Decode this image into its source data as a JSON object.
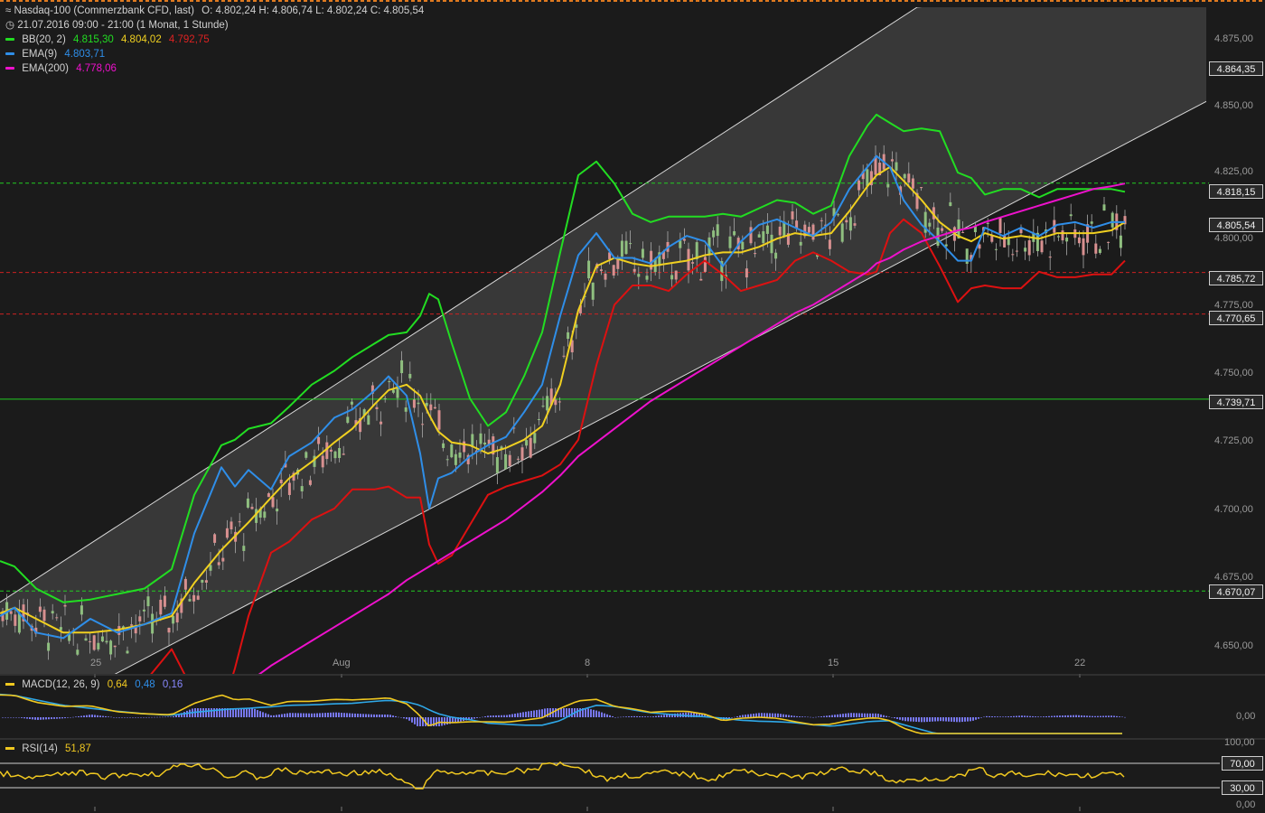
{
  "header": {
    "instrument": "Nasdaq-100 (Commerzbank CFD, last)",
    "ohlc": "O: 4.802,24  H: 4.806,74  L: 4.802,24  C: 4.805,54",
    "timerange": "21.07.2016 09:00 - 21:00 (1 Monat, 1 Stunde)",
    "bb_label": "BB(20, 2)",
    "bb_upper": "4.815,30",
    "bb_mid": "4.804,02",
    "bb_lower": "4.792,75",
    "ema9_label": "EMA(9)",
    "ema9_value": "4.803,71",
    "ema200_label": "EMA(200)",
    "ema200_value": "4.778,06"
  },
  "colors": {
    "background": "#1b1b1b",
    "bb_upper": "#22dd22",
    "bb_mid": "#f0d020",
    "bb_lower": "#dd1111",
    "ema9": "#2f8ee8",
    "ema200": "#ee11cc",
    "candle_up": "#8fbf7f",
    "candle_down": "#d89090",
    "macd_hist": "#7777ee",
    "rsi": "#f0c820"
  },
  "price_axis": [
    "4.875,00",
    "4.850,00",
    "4.825,00",
    "4.800,00",
    "4.775,00",
    "4.750,00",
    "4.725,00",
    "4.700,00",
    "4.675,00",
    "4.650,00"
  ],
  "price_tags": {
    "current": "4.805,54",
    "top": "4.864,35",
    "upper_green": "4.818,15",
    "red_1": "4.785,72",
    "red_2": "4.770,65",
    "green_solid": "4.739,71",
    "lower_green": "4.670,07"
  },
  "x_axis": [
    "25",
    "Aug",
    "8",
    "15",
    "22"
  ],
  "macd": {
    "label": "MACD(12, 26, 9)",
    "v1": "0,64",
    "v2": "0,48",
    "v3": "0,16",
    "axis": "0,00"
  },
  "rsi": {
    "label": "RSI(14)",
    "value": "51,87",
    "axis_top": "100,00",
    "axis_70": "70,00",
    "axis_30": "30,00",
    "axis_bottom": "0,00"
  },
  "chart_data": {
    "type": "line",
    "ylim": [
      4640,
      4882
    ],
    "x": [
      0,
      16,
      40,
      70,
      100,
      130,
      160,
      190,
      215,
      245,
      260,
      275,
      300,
      320,
      345,
      370,
      390,
      415,
      430,
      450,
      465,
      475,
      485,
      500,
      520,
      540,
      560,
      580,
      600,
      620,
      640,
      660,
      680,
      700,
      720,
      740,
      760,
      780,
      800,
      820,
      840,
      860,
      880,
      900,
      920,
      940,
      960,
      970,
      985,
      1000,
      1020,
      1040,
      1060,
      1075,
      1090,
      1110,
      1130,
      1150,
      1170,
      1190,
      1210,
      1230,
      1245
    ],
    "series": [
      {
        "name": "BB(20, 2)",
        "color": "#22dd22",
        "values": [
          4681,
          4679,
          4671,
          4666,
          4667,
          4669,
          4671,
          4678,
          4705,
          4723,
          4725,
          4729,
          4731,
          4737,
          4745,
          4750,
          4755,
          4760,
          4763,
          4764,
          4770,
          4778,
          4776,
          4760,
          4740,
          4730,
          4735,
          4748,
          4764,
          4793,
          4821,
          4826,
          4818,
          4807,
          4804,
          4806,
          4806,
          4806,
          4807,
          4806,
          4809,
          4812,
          4811,
          4807,
          4810,
          4828,
          4839,
          4843,
          4840,
          4837,
          4838,
          4837,
          4822,
          4820,
          4814,
          4816,
          4816,
          4813,
          4816,
          4816,
          4816,
          4816,
          4815
        ]
      },
      {
        "name": "BB(20, 2)",
        "color": "#f0d020",
        "values": [
          4662,
          4664,
          4660,
          4655,
          4655,
          4656,
          4658,
          4661,
          4673,
          4685,
          4690,
          4695,
          4704,
          4711,
          4717,
          4724,
          4729,
          4738,
          4743,
          4745,
          4741,
          4734,
          4728,
          4724,
          4723,
          4720,
          4722,
          4725,
          4730,
          4745,
          4772,
          4788,
          4791,
          4789,
          4788,
          4789,
          4790,
          4792,
          4793,
          4793,
          4795,
          4798,
          4800,
          4799,
          4800,
          4808,
          4817,
          4821,
          4824,
          4819,
          4812,
          4804,
          4799,
          4797,
          4800,
          4798,
          4799,
          4798,
          4800,
          4800,
          4800,
          4801,
          4804
        ]
      },
      {
        "name": "BB(20, 2)",
        "color": "#dd1111",
        "values": [
          4626,
          4627,
          4628,
          4631,
          4635,
          4630,
          4637,
          4649,
          4633,
          4626,
          4642,
          4661,
          4684,
          4688,
          4696,
          4700,
          4707,
          4707,
          4708,
          4704,
          4704,
          4687,
          4680,
          4683,
          4694,
          4705,
          4708,
          4710,
          4712,
          4716,
          4725,
          4752,
          4774,
          4781,
          4781,
          4779,
          4785,
          4790,
          4785,
          4779,
          4781,
          4783,
          4790,
          4793,
          4790,
          4786,
          4785,
          4786,
          4800,
          4805,
          4800,
          4788,
          4775,
          4780,
          4781,
          4780,
          4780,
          4786,
          4784,
          4784,
          4785,
          4785,
          4790
        ]
      },
      {
        "name": "EMA(9)",
        "color": "#2f8ee8",
        "values": [
          4661,
          4664,
          4655,
          4653,
          4660,
          4655,
          4658,
          4662,
          4691,
          4715,
          4708,
          4714,
          4707,
          4719,
          4724,
          4733,
          4736,
          4743,
          4748,
          4741,
          4720,
          4700,
          4711,
          4713,
          4719,
          4723,
          4726,
          4735,
          4745,
          4770,
          4792,
          4800,
          4791,
          4791,
          4789,
          4795,
          4799,
          4797,
          4788,
          4797,
          4803,
          4805,
          4802,
          4799,
          4804,
          4816,
          4824,
          4828,
          4824,
          4812,
          4803,
          4797,
          4790,
          4790,
          4802,
          4799,
          4802,
          4799,
          4803,
          4804,
          4802,
          4804,
          4804
        ]
      },
      {
        "name": "EMA(200)",
        "color": "#ee11cc",
        "values": [
          4576,
          4580,
          4585,
          4591,
          4597,
          4604,
          4611,
          4617,
          4623,
          4630,
          4633,
          4637,
          4643,
          4647,
          4652,
          4657,
          4661,
          4666,
          4669,
          4674,
          4677,
          4679,
          4681,
          4684,
          4688,
          4692,
          4696,
          4701,
          4706,
          4712,
          4719,
          4724,
          4729,
          4734,
          4739,
          4743,
          4747,
          4751,
          4755,
          4759,
          4763,
          4767,
          4771,
          4774,
          4778,
          4782,
          4786,
          4789,
          4791,
          4794,
          4797,
          4799,
          4801,
          4802,
          4804,
          4806,
          4808,
          4810,
          4812,
          4814,
          4816,
          4817,
          4818
        ]
      }
    ],
    "channel": {
      "upper": [
        [
          0,
          4666
        ],
        [
          1015,
          4882
        ],
        [
          1400,
          4894
        ]
      ],
      "lower": [
        [
          0,
          4618
        ],
        [
          1400,
          4859
        ]
      ]
    },
    "hlines": [
      {
        "value": 4818.15,
        "color": "#22cc22",
        "dashed": true
      },
      {
        "value": 4785.72,
        "color": "#cc2222",
        "dashed": true
      },
      {
        "value": 4770.65,
        "color": "#cc2222",
        "dashed": true
      },
      {
        "value": 4739.71,
        "color": "#22cc22",
        "dashed": false
      },
      {
        "value": 4670.07,
        "color": "#22cc22",
        "dashed": true
      }
    ],
    "xticks": [
      105,
      378,
      650,
      922,
      1195
    ]
  }
}
